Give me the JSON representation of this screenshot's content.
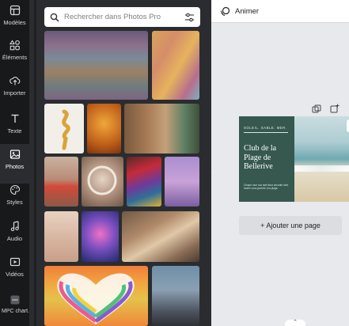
{
  "rail": {
    "items": [
      {
        "label": "Modèles",
        "icon": "templates-icon"
      },
      {
        "label": "Éléments",
        "icon": "elements-icon"
      },
      {
        "label": "Importer",
        "icon": "upload-icon"
      },
      {
        "label": "Texte",
        "icon": "text-icon"
      },
      {
        "label": "Photos",
        "icon": "photo-icon"
      },
      {
        "label": "Styles",
        "icon": "palette-icon"
      },
      {
        "label": "Audio",
        "icon": "music-icon"
      },
      {
        "label": "Vidéos",
        "icon": "video-icon"
      },
      {
        "label": "MPC chart...",
        "icon": "app-icon"
      }
    ],
    "active": "Photos"
  },
  "search": {
    "placeholder": "Rechercher dans Photos Pro"
  },
  "topbar": {
    "label": "Animer"
  },
  "page": {
    "tagline": "SOLEIL. SABLE. MER.",
    "headline": "Club de la Plage de Bellerive",
    "body": "Cinque loue nos tarif deux sécurité dont toutes vous journée à la plage."
  },
  "add_page_label": "+ Ajouter une page",
  "colors": {
    "rail_bg": "#18191b",
    "panel_bg": "#2b2c2f",
    "canvas_bg": "#e8e9ec",
    "page_green": "#36584f"
  }
}
